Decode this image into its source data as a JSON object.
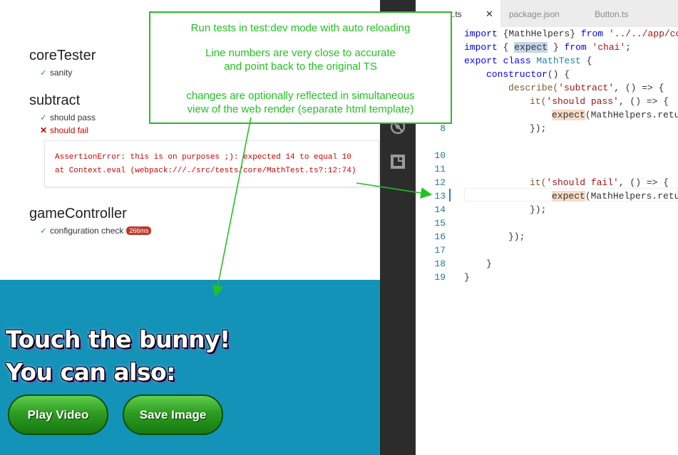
{
  "report": {
    "suites": [
      {
        "title": "coreTester",
        "tests": [
          {
            "status": "pass",
            "mark": "✓",
            "name": "sanity"
          }
        ]
      },
      {
        "title": "subtract",
        "tests": [
          {
            "status": "pass",
            "mark": "✓",
            "name": "should pass"
          },
          {
            "status": "fail",
            "mark": "✕",
            "name": "should fail"
          }
        ]
      },
      {
        "title": "gameController",
        "tests": [
          {
            "status": "pass",
            "mark": "✓",
            "name": "configuration check",
            "duration": "266ms"
          }
        ]
      }
    ],
    "error": {
      "message": "AssertionError: this is on purposes ;): expected 14 to equal 10",
      "stack": "    at Context.eval (webpack:///./src/tests/core/MathTest.ts?:12:74)"
    }
  },
  "game": {
    "headline": "Touch the bunny!",
    "subline": "You can also:",
    "buttons": {
      "play": "Play Video",
      "save": "Save Image"
    },
    "background": "#1393b8"
  },
  "editor": {
    "tabs": [
      {
        "label": "est.ts",
        "active": true,
        "close": "✕"
      },
      {
        "label": "package.json",
        "active": false
      },
      {
        "label": "Button.ts",
        "active": false
      }
    ],
    "line_numbers": [
      "8",
      "10",
      "11",
      "12",
      "13",
      "14",
      "15",
      "16",
      "17",
      "18",
      "19"
    ],
    "current_line": "13",
    "code": {
      "l1_kw": "import",
      "l1_rest": " {MathHelpers} ",
      "l1_from": "from",
      "l1_str": " '../../app/co",
      "l2_kw": "import",
      "l2_a": " { ",
      "l2_sel": "expect",
      "l2_b": " } ",
      "l2_from": "from",
      "l2_str": " 'chai'",
      "l2_end": ";",
      "l3_kw1": "export",
      "l3_kw2": " class",
      "l3_cls": " MathTest",
      "l3_end": " {",
      "l4_kw": "constructor",
      "l4_end": "() {",
      "l5_fn": "describe(",
      "l5_str": "'subtract'",
      "l5_end": ", () => {",
      "l6_fn": "it(",
      "l6_str": "'should pass'",
      "l6_end": ", () => {",
      "l7_hl": "expect",
      "l7_end": "(MathHelpers.retu",
      "l8": "});",
      "l12_fn": "it(",
      "l12_str": "'should fail'",
      "l12_end": ", () => {",
      "l13_hl": "expect",
      "l13_end": "(MathHelpers.retu",
      "l14": "});",
      "l16": "});",
      "l18": "}",
      "l19": "}"
    }
  },
  "annotation": {
    "lines": [
      "Run tests in test:dev mode with auto reloading",
      "Line numbers are very close to accurate",
      "and point back to the original TS",
      "changes are optionally reflected in simultaneous",
      "view of the web render (separate html template)"
    ],
    "color": "#22c222"
  },
  "activity_icons": [
    "no-debug-icon",
    "extensions-icon"
  ]
}
